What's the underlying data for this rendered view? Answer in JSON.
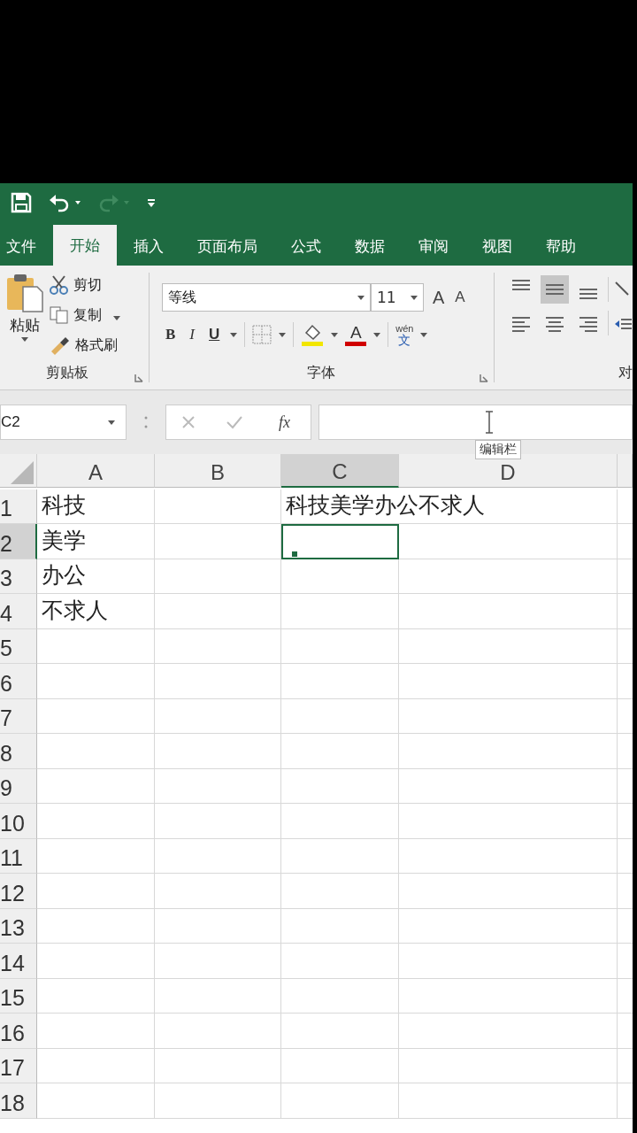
{
  "tabs": [
    {
      "label": "文件",
      "selected": false
    },
    {
      "label": "开始",
      "selected": true
    },
    {
      "label": "插入",
      "selected": false
    },
    {
      "label": "页面布局",
      "selected": false
    },
    {
      "label": "公式",
      "selected": false
    },
    {
      "label": "数据",
      "selected": false
    },
    {
      "label": "审阅",
      "selected": false
    },
    {
      "label": "视图",
      "selected": false
    },
    {
      "label": "帮助",
      "selected": false
    }
  ],
  "clipboard": {
    "paste": "粘贴",
    "cut": "剪切",
    "copy": "复制",
    "format_painter": "格式刷",
    "label": "剪贴板"
  },
  "font": {
    "name": "等线",
    "size": "11",
    "grow": "A",
    "shrink": "A",
    "bold": "B",
    "italic": "I",
    "underline": "U",
    "font_color": "A",
    "phonetic_top": "wén",
    "phonetic_bottom": "文",
    "label": "字体"
  },
  "alignment": {
    "vertical": [
      {
        "selected": false
      },
      {
        "selected": true
      },
      {
        "selected": false
      }
    ],
    "label": "对"
  },
  "formula_bar": {
    "name_box": "C2",
    "fx": "fx",
    "tooltip": "编辑栏"
  },
  "columns": [
    {
      "label": "A",
      "selected": false
    },
    {
      "label": "B",
      "selected": false
    },
    {
      "label": "C",
      "selected": true
    },
    {
      "label": "D",
      "selected": false
    }
  ],
  "rows": [
    {
      "label": "1",
      "selected": false,
      "cells": [
        "科技",
        "",
        "科技美学办公不求人",
        ""
      ]
    },
    {
      "label": "2",
      "selected": true,
      "cells": [
        "美学",
        "",
        "",
        ""
      ]
    },
    {
      "label": "3",
      "selected": false,
      "cells": [
        "办公",
        "",
        "",
        ""
      ]
    },
    {
      "label": "4",
      "selected": false,
      "cells": [
        "不求人",
        "",
        "",
        ""
      ]
    },
    {
      "label": "5",
      "selected": false,
      "cells": [
        "",
        "",
        "",
        ""
      ]
    },
    {
      "label": "6",
      "selected": false,
      "cells": [
        "",
        "",
        "",
        ""
      ]
    },
    {
      "label": "7",
      "selected": false,
      "cells": [
        "",
        "",
        "",
        ""
      ]
    },
    {
      "label": "8",
      "selected": false,
      "cells": [
        "",
        "",
        "",
        ""
      ]
    },
    {
      "label": "9",
      "selected": false,
      "cells": [
        "",
        "",
        "",
        ""
      ]
    },
    {
      "label": "10",
      "selected": false,
      "cells": [
        "",
        "",
        "",
        ""
      ]
    },
    {
      "label": "11",
      "selected": false,
      "cells": [
        "",
        "",
        "",
        ""
      ]
    },
    {
      "label": "12",
      "selected": false,
      "cells": [
        "",
        "",
        "",
        ""
      ]
    },
    {
      "label": "13",
      "selected": false,
      "cells": [
        "",
        "",
        "",
        ""
      ]
    },
    {
      "label": "14",
      "selected": false,
      "cells": [
        "",
        "",
        "",
        ""
      ]
    },
    {
      "label": "15",
      "selected": false,
      "cells": [
        "",
        "",
        "",
        ""
      ]
    },
    {
      "label": "16",
      "selected": false,
      "cells": [
        "",
        "",
        "",
        ""
      ]
    },
    {
      "label": "17",
      "selected": false,
      "cells": [
        "",
        "",
        "",
        ""
      ]
    },
    {
      "label": "18",
      "selected": false,
      "cells": [
        "",
        "",
        "",
        ""
      ]
    }
  ]
}
